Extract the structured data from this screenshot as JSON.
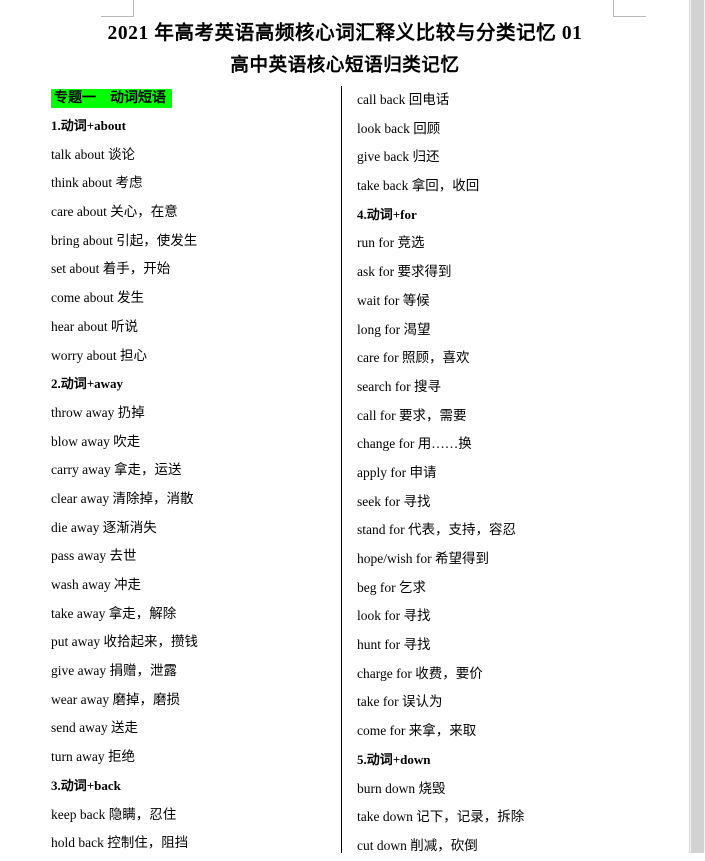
{
  "document": {
    "title_main": "2021 年高考英语高频核心词汇释义比较与分类记忆 01",
    "title_sub": "高中英语核心短语归类记忆",
    "highlight_color": "#00ff00"
  },
  "left_column": [
    {
      "type": "section",
      "text": "专题一　动词短语"
    },
    {
      "type": "heading",
      "text": "1.动词+about"
    },
    {
      "type": "entry",
      "text": "talk about 谈论"
    },
    {
      "type": "entry",
      "text": "think about 考虑"
    },
    {
      "type": "entry",
      "text": "care about 关心，在意"
    },
    {
      "type": "entry",
      "text": "bring about 引起，使发生"
    },
    {
      "type": "entry",
      "text": "set about 着手，开始"
    },
    {
      "type": "entry",
      "text": "come about 发生"
    },
    {
      "type": "entry",
      "text": "hear about 听说"
    },
    {
      "type": "entry",
      "text": "worry about 担心"
    },
    {
      "type": "heading",
      "text": "2.动词+away"
    },
    {
      "type": "entry",
      "text": "throw away 扔掉"
    },
    {
      "type": "entry",
      "text": "blow away 吹走"
    },
    {
      "type": "entry",
      "text": "carry away 拿走，运送"
    },
    {
      "type": "entry",
      "text": "clear away 清除掉，消散"
    },
    {
      "type": "entry",
      "text": "die away 逐渐消失"
    },
    {
      "type": "entry",
      "text": "pass away 去世"
    },
    {
      "type": "entry",
      "text": "wash away 冲走"
    },
    {
      "type": "entry",
      "text": "take away 拿走，解除"
    },
    {
      "type": "entry",
      "text": "put away 收拾起来，攒钱"
    },
    {
      "type": "entry",
      "text": "give away 捐赠，泄露"
    },
    {
      "type": "entry",
      "text": "wear away 磨掉，磨损"
    },
    {
      "type": "entry",
      "text": "send away 送走"
    },
    {
      "type": "entry",
      "text": "turn away 拒绝"
    },
    {
      "type": "heading",
      "text": "3.动词+back"
    },
    {
      "type": "entry",
      "text": "keep back 隐瞒，忍住"
    },
    {
      "type": "entry",
      "text": "hold back 控制住，阻挡"
    }
  ],
  "right_column": [
    {
      "type": "entry",
      "text": "call back 回电话"
    },
    {
      "type": "entry",
      "text": "look back 回顾"
    },
    {
      "type": "entry",
      "text": "give back 归还"
    },
    {
      "type": "entry",
      "text": "take back 拿回，收回"
    },
    {
      "type": "heading",
      "text": "4.动词+for"
    },
    {
      "type": "entry",
      "text": "run for 竞选"
    },
    {
      "type": "entry",
      "text": "ask for 要求得到"
    },
    {
      "type": "entry",
      "text": "wait for 等候"
    },
    {
      "type": "entry",
      "text": "long for 渴望"
    },
    {
      "type": "entry",
      "text": "care for 照顾，喜欢"
    },
    {
      "type": "entry",
      "text": "search for 搜寻"
    },
    {
      "type": "entry",
      "text": "call for 要求，需要"
    },
    {
      "type": "entry",
      "text": "change for 用……换"
    },
    {
      "type": "entry",
      "text": "apply for 申请"
    },
    {
      "type": "entry",
      "text": "seek for 寻找"
    },
    {
      "type": "entry",
      "text": "stand for 代表，支持，容忍"
    },
    {
      "type": "entry",
      "text": "hope/wish for 希望得到"
    },
    {
      "type": "entry",
      "text": "beg for 乞求"
    },
    {
      "type": "entry",
      "text": "look for 寻找"
    },
    {
      "type": "entry",
      "text": "hunt for 寻找"
    },
    {
      "type": "entry",
      "text": "charge for 收费，要价"
    },
    {
      "type": "entry",
      "text": "take for 误认为"
    },
    {
      "type": "entry",
      "text": "come for 来拿，来取"
    },
    {
      "type": "heading",
      "text": "5.动词+down"
    },
    {
      "type": "entry",
      "text": "burn down 烧毁"
    },
    {
      "type": "entry",
      "text": "take down 记下，记录，拆除"
    },
    {
      "type": "entry",
      "text": "cut down 削减，砍倒"
    }
  ]
}
